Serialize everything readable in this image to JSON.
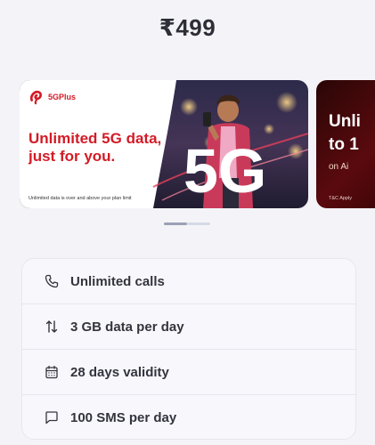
{
  "plan": {
    "price": "₹499"
  },
  "carousel": {
    "main": {
      "brand": "5GPlus",
      "headline_line1": "Unlimited 5G data,",
      "headline_line2": "just for you.",
      "big_text": "5G",
      "footnote": "Unlimited data is over and above your plan limit"
    },
    "peek": {
      "line1": "Unli",
      "line2": "to 1",
      "line3": "on Ai",
      "tc": "T&C Apply"
    },
    "dots": {
      "count": 2,
      "active_index": 0
    }
  },
  "benefits": [
    {
      "icon": "phone-icon",
      "label": "Unlimited calls"
    },
    {
      "icon": "data-arrows-icon",
      "label": "3 GB data per day"
    },
    {
      "icon": "calendar-icon",
      "label": "28 days validity"
    },
    {
      "icon": "message-icon",
      "label": "100 SMS per day"
    }
  ],
  "colors": {
    "brand_red": "#d31b26",
    "page_bg": "#f4f4f8",
    "text_dark": "#2e2e38"
  }
}
